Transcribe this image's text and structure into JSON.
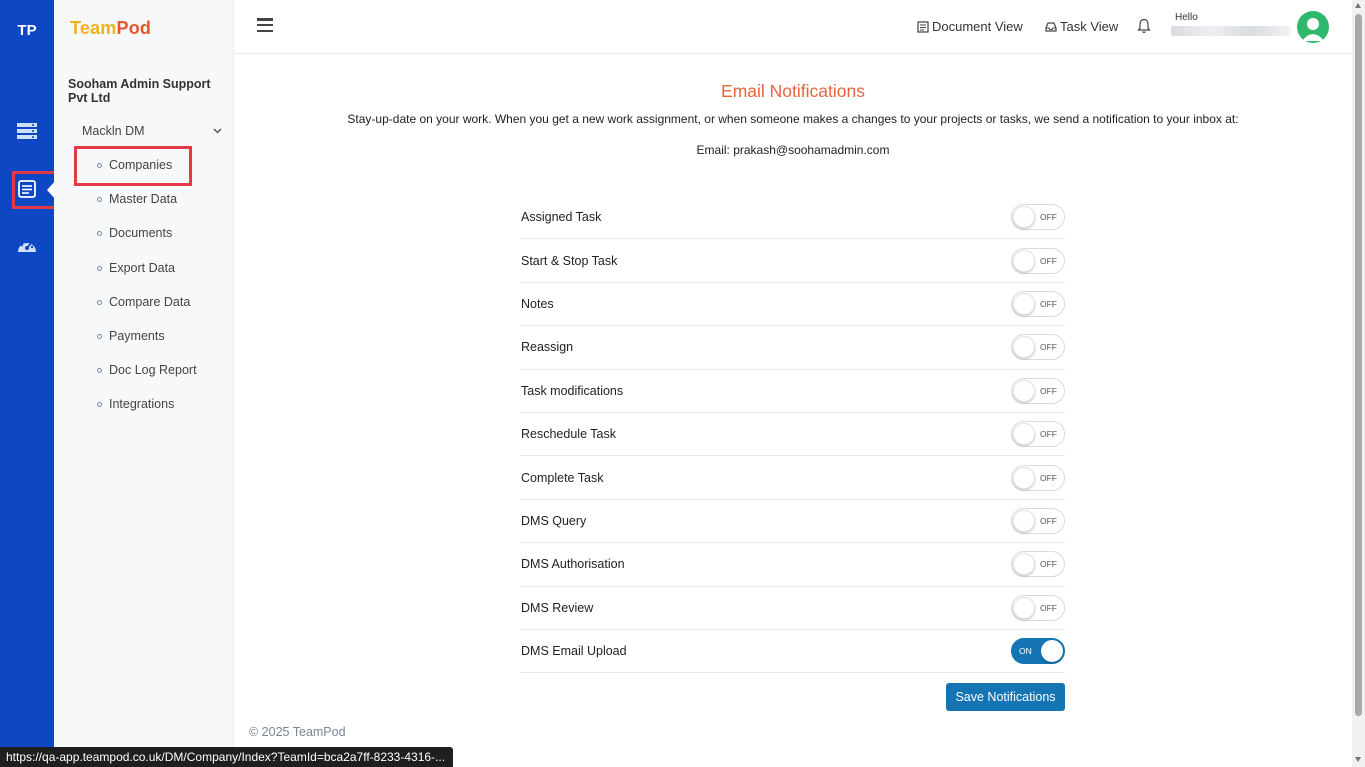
{
  "rail": {
    "brand": "TP"
  },
  "sidebar": {
    "logo_part1": "Team",
    "logo_part2": "Pod",
    "org_name": "Sooham Admin Support Pvt Ltd",
    "group_label": "Mackln DM",
    "items": [
      {
        "label": "Companies"
      },
      {
        "label": "Master Data"
      },
      {
        "label": "Documents"
      },
      {
        "label": "Export Data"
      },
      {
        "label": "Compare Data"
      },
      {
        "label": "Payments"
      },
      {
        "label": "Doc Log Report"
      },
      {
        "label": "Integrations"
      }
    ]
  },
  "header": {
    "document_view": "Document View",
    "task_view": "Task View",
    "hello": "Hello"
  },
  "main": {
    "title": "Email Notifications",
    "intro": "Stay-up-date on your work. When you get a new work assignment, or when someone makes a changes to your projects or tasks, we send a notification to your inbox at:",
    "email_line": "Email: prakash@soohamadmin.com",
    "settings": [
      {
        "label": "Assigned Task",
        "state": "OFF"
      },
      {
        "label": "Start & Stop Task",
        "state": "OFF"
      },
      {
        "label": "Notes",
        "state": "OFF"
      },
      {
        "label": "Reassign",
        "state": "OFF"
      },
      {
        "label": "Task modifications",
        "state": "OFF"
      },
      {
        "label": "Reschedule Task",
        "state": "OFF"
      },
      {
        "label": "Complete Task",
        "state": "OFF"
      },
      {
        "label": "DMS Query",
        "state": "OFF"
      },
      {
        "label": "DMS Authorisation",
        "state": "OFF"
      },
      {
        "label": "DMS Review",
        "state": "OFF"
      },
      {
        "label": "DMS Email Upload",
        "state": "ON"
      }
    ],
    "save_label": "Save Notifications"
  },
  "footer": {
    "copyright": "© 2025 TeamPod"
  },
  "status_bar": {
    "url": "https://qa-app.teampod.co.uk/DM/Company/Index?TeamId=bca2a7ff-8233-4316-..."
  },
  "colors": {
    "rail": "#0d47c4",
    "accent": "#e8643f",
    "primary": "#1574b3",
    "highlight": "#e03a46"
  }
}
